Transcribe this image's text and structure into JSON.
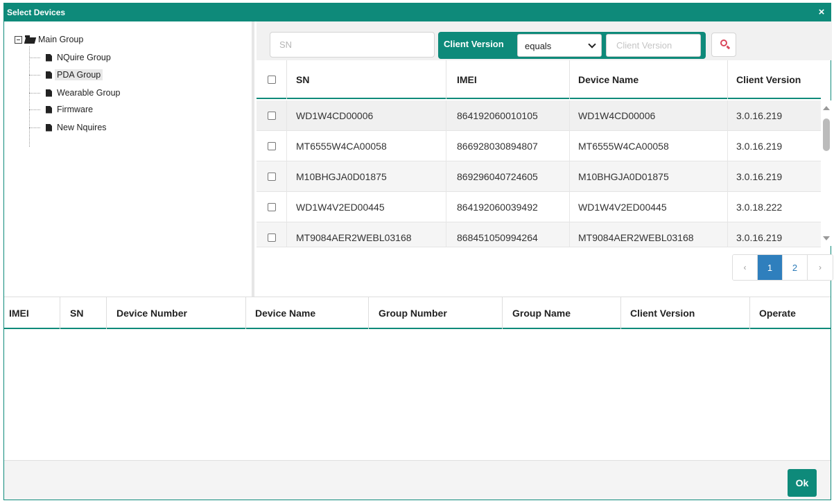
{
  "dialog": {
    "title": "Select Devices",
    "close_glyph": "×"
  },
  "tree": {
    "root": "Main Group",
    "children": [
      {
        "label": "NQuire Group",
        "selected": false
      },
      {
        "label": "PDA Group",
        "selected": true
      },
      {
        "label": "Wearable Group",
        "selected": false
      },
      {
        "label": "Firmware",
        "selected": false
      },
      {
        "label": "New Nquires",
        "selected": false
      }
    ]
  },
  "search": {
    "sn_placeholder": "SN",
    "client_version_label": "Client Version",
    "operator_value": "equals",
    "client_version_placeholder": "Client Version"
  },
  "device_grid": {
    "columns": [
      "SN",
      "IMEI",
      "Device Name",
      "Client Version"
    ],
    "rows": [
      {
        "sn": "WD1W4CD00006",
        "imei": "864192060010105",
        "device_name": "WD1W4CD00006",
        "client_version": "3.0.16.219"
      },
      {
        "sn": "MT6555W4CA00058",
        "imei": "866928030894807",
        "device_name": "MT6555W4CA00058",
        "client_version": "3.0.16.219"
      },
      {
        "sn": "M10BHGJA0D01875",
        "imei": "869296040724605",
        "device_name": "M10BHGJA0D01875",
        "client_version": "3.0.16.219"
      },
      {
        "sn": "WD1W4V2ED00445",
        "imei": "864192060039492",
        "device_name": "WD1W4V2ED00445",
        "client_version": "3.0.18.222"
      },
      {
        "sn": "MT9084AER2WEBL03168",
        "imei": "868451050994264",
        "device_name": "MT9084AER2WEBL03168",
        "client_version": "3.0.16.219"
      }
    ]
  },
  "pager": {
    "prev": "‹",
    "pages": [
      "1",
      "2"
    ],
    "current": "1",
    "next": "›"
  },
  "selected_table": {
    "columns": [
      "IMEI",
      "SN",
      "Device Number",
      "Device Name",
      "Group Number",
      "Group Name",
      "Client Version",
      "Operate"
    ]
  },
  "footer": {
    "ok_label": "Ok"
  },
  "colors": {
    "accent": "#0e8a7a",
    "pager_active": "#2f7fbd",
    "search_icon": "#d9465a"
  }
}
